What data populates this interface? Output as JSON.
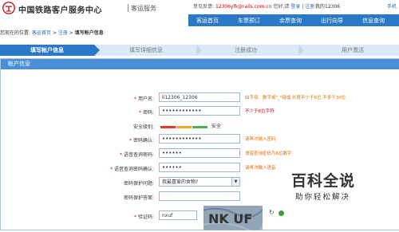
{
  "header": {
    "brand": "中国铁路客户服务中心",
    "brand_sub": "客运服务",
    "feedback_label": "意见反馈:",
    "feedback_email": "12306yfk@rails.com.cn",
    "greeting": "您好,请",
    "login": "登录",
    "register": "注册",
    "separator": "|",
    "my_account": "我的12306",
    "mobile": "手机"
  },
  "nav": {
    "items": [
      "客运首页",
      "车票预订",
      "余票查询",
      "出行向导",
      "信息查询"
    ]
  },
  "breadcrumb": {
    "prefix": "您现在的位置:",
    "items": [
      "客运首页",
      "注册",
      "填写帐户信息"
    ],
    "sep": ">"
  },
  "steps": [
    "填写帐户信息",
    "填写详细信息",
    "注册成功",
    "用户激活"
  ],
  "panel": {
    "title": "帐户信息"
  },
  "form": {
    "username": {
      "label": "用户名:",
      "value": "li12306_12306",
      "hint": "由字母、数字或\"_\"组成,长度不少于6位,不多于30位"
    },
    "password": {
      "label": "密码:",
      "value": "••••••••••••",
      "hint": "不少于6位字符"
    },
    "strength": {
      "label": "安全级别:",
      "text": "安全",
      "colors": [
        "#e8332a",
        "#f5a623",
        "#4caf50"
      ]
    },
    "password_confirm": {
      "label": "密码确认:",
      "value": "••••••••••••",
      "hint": "请再次输入密码"
    },
    "query_pw": {
      "label": "语音查询密码:",
      "value": "••••••",
      "hint": "语音查询密码为6位数字"
    },
    "query_pw_confirm": {
      "label": "语音查询密码确认:",
      "value": "••••••",
      "hint": "请再次输入语音"
    },
    "question": {
      "label": "密码保护问题:",
      "value": "我最喜爱的食物?"
    },
    "answer": {
      "label": "密码保护答案:",
      "value": ""
    },
    "captcha": {
      "label": "验证码:",
      "value": "nxuf",
      "image_text": "NK UF"
    }
  },
  "watermark": {
    "title": "百科全说",
    "subtitle": "助你轻松解决"
  }
}
